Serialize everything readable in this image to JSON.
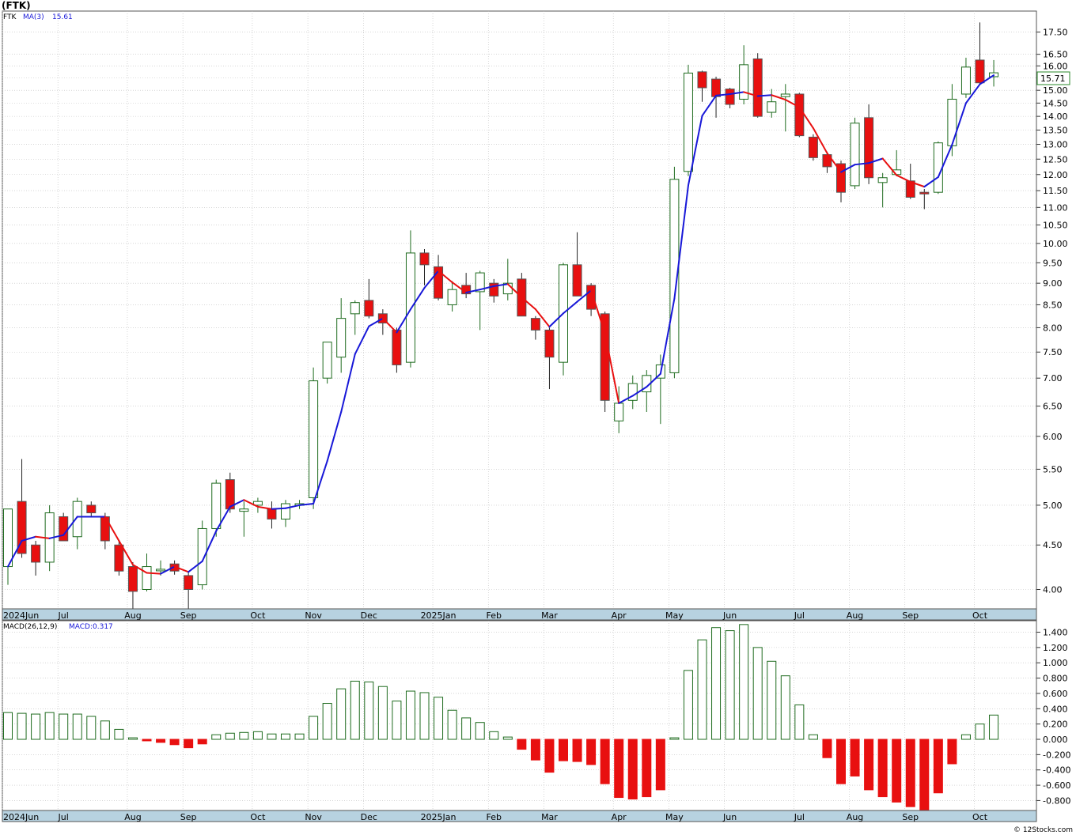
{
  "header": {
    "title": "(FTK)"
  },
  "footer": {
    "credit": "© 12Stocks.com"
  },
  "colors": {
    "up": "#1e6b1e",
    "down": "#e81010",
    "ma_up": "#1818d8",
    "ma_down": "#e81010",
    "grid": "#bdbdbd",
    "axis_band": "#b7d2e0"
  },
  "price_panel": {
    "legend": {
      "symbol": "FTK",
      "ma_label": "MA(3)",
      "ma_value": "15.61"
    },
    "last_price_label": "15.71"
  },
  "macd_panel": {
    "legend": {
      "name": "MACD(26,12,9)",
      "value_label": "MACD:0.317"
    }
  },
  "chart_data": [
    {
      "type": "candlestick",
      "title": "(FTK)",
      "scale": "log",
      "ylim": [
        3.8,
        18.5
      ],
      "y_ticks": [
        4.0,
        4.5,
        5.0,
        5.5,
        6.0,
        6.5,
        7.0,
        7.5,
        8.0,
        8.5,
        9.0,
        9.5,
        10.0,
        10.5,
        11.0,
        11.5,
        12.0,
        12.5,
        13.0,
        13.5,
        14.0,
        14.5,
        15.0,
        15.5,
        16.0,
        16.5,
        17.5
      ],
      "y_tick_labels": [
        "4.00",
        "4.50",
        "5.00",
        "5.50",
        "6.00",
        "6.50",
        "7.00",
        "7.50",
        "8.00",
        "8.50",
        "9.00",
        "9.50",
        "10.00",
        "10.50",
        "11.00",
        "11.50",
        "12.00",
        "12.50",
        "13.00",
        "13.50",
        "14.00",
        "14.50",
        "15.00",
        "15.50",
        "16.00",
        "16.50",
        "17.50"
      ],
      "x_labels": [
        {
          "label": "2024Jun",
          "week": 0
        },
        {
          "label": "Jul",
          "week": 4
        },
        {
          "label": "Aug",
          "week": 9
        },
        {
          "label": "Sep",
          "week": 13
        },
        {
          "label": "Oct",
          "week": 18
        },
        {
          "label": "Nov",
          "week": 22
        },
        {
          "label": "Dec",
          "week": 26
        },
        {
          "label": "2025Jan",
          "week": 31
        },
        {
          "label": "Feb",
          "week": 35
        },
        {
          "label": "Mar",
          "week": 39
        },
        {
          "label": "Apr",
          "week": 44
        },
        {
          "label": "May",
          "week": 48
        },
        {
          "label": "Jun",
          "week": 52
        },
        {
          "label": "Jul",
          "week": 57
        },
        {
          "label": "Aug",
          "week": 61
        },
        {
          "label": "Sep",
          "week": 65
        },
        {
          "label": "Oct",
          "week": 70
        }
      ],
      "grid": true,
      "candles": [
        {
          "o": 4.25,
          "h": 4.95,
          "l": 4.05,
          "c": 4.95
        },
        {
          "o": 5.05,
          "h": 5.65,
          "l": 4.35,
          "c": 4.4
        },
        {
          "o": 4.5,
          "h": 4.55,
          "l": 4.15,
          "c": 4.3
        },
        {
          "o": 4.3,
          "h": 5.0,
          "l": 4.2,
          "c": 4.9
        },
        {
          "o": 4.85,
          "h": 4.9,
          "l": 4.55,
          "c": 4.55
        },
        {
          "o": 4.6,
          "h": 5.1,
          "l": 4.45,
          "c": 5.05
        },
        {
          "o": 5.0,
          "h": 5.05,
          "l": 4.85,
          "c": 4.9
        },
        {
          "o": 4.85,
          "h": 4.9,
          "l": 4.45,
          "c": 4.55
        },
        {
          "o": 4.5,
          "h": 4.55,
          "l": 4.15,
          "c": 4.2
        },
        {
          "o": 4.25,
          "h": 4.3,
          "l": 3.8,
          "c": 3.98
        },
        {
          "o": 4.0,
          "h": 4.4,
          "l": 3.98,
          "c": 4.25
        },
        {
          "o": 4.22,
          "h": 4.32,
          "l": 4.15,
          "c": 4.22
        },
        {
          "o": 4.28,
          "h": 4.32,
          "l": 4.16,
          "c": 4.2
        },
        {
          "o": 4.15,
          "h": 4.2,
          "l": 3.8,
          "c": 4.0
        },
        {
          "o": 4.05,
          "h": 4.8,
          "l": 4.0,
          "c": 4.7
        },
        {
          "o": 4.7,
          "h": 5.35,
          "l": 4.6,
          "c": 5.3
        },
        {
          "o": 5.35,
          "h": 5.45,
          "l": 4.9,
          "c": 4.95
        },
        {
          "o": 4.92,
          "h": 5.05,
          "l": 4.6,
          "c": 4.95
        },
        {
          "o": 5.0,
          "h": 5.1,
          "l": 4.9,
          "c": 5.05
        },
        {
          "o": 4.95,
          "h": 5.05,
          "l": 4.7,
          "c": 4.82
        },
        {
          "o": 4.82,
          "h": 5.07,
          "l": 4.72,
          "c": 5.02
        },
        {
          "o": 5.0,
          "h": 5.07,
          "l": 4.95,
          "c": 5.02
        },
        {
          "o": 5.1,
          "h": 7.2,
          "l": 4.95,
          "c": 6.95
        },
        {
          "o": 7.0,
          "h": 7.7,
          "l": 6.9,
          "c": 7.7
        },
        {
          "o": 7.4,
          "h": 8.65,
          "l": 7.1,
          "c": 8.2
        },
        {
          "o": 8.3,
          "h": 8.6,
          "l": 7.85,
          "c": 8.55
        },
        {
          "o": 8.6,
          "h": 9.1,
          "l": 8.2,
          "c": 8.25
        },
        {
          "o": 8.3,
          "h": 8.4,
          "l": 7.85,
          "c": 8.1
        },
        {
          "o": 7.95,
          "h": 8.0,
          "l": 7.1,
          "c": 7.25
        },
        {
          "o": 7.3,
          "h": 10.35,
          "l": 7.2,
          "c": 9.75
        },
        {
          "o": 9.75,
          "h": 9.85,
          "l": 8.95,
          "c": 9.45
        },
        {
          "o": 9.4,
          "h": 9.7,
          "l": 8.6,
          "c": 8.65
        },
        {
          "o": 8.5,
          "h": 9.05,
          "l": 8.35,
          "c": 8.85
        },
        {
          "o": 8.95,
          "h": 9.25,
          "l": 8.65,
          "c": 8.75
        },
        {
          "o": 8.8,
          "h": 9.3,
          "l": 7.95,
          "c": 9.25
        },
        {
          "o": 9.0,
          "h": 9.1,
          "l": 8.55,
          "c": 8.7
        },
        {
          "o": 8.75,
          "h": 9.6,
          "l": 8.6,
          "c": 9.0
        },
        {
          "o": 9.1,
          "h": 9.25,
          "l": 8.25,
          "c": 8.25
        },
        {
          "o": 8.2,
          "h": 8.25,
          "l": 7.75,
          "c": 7.95
        },
        {
          "o": 7.95,
          "h": 8.0,
          "l": 6.8,
          "c": 7.4
        },
        {
          "o": 7.3,
          "h": 9.5,
          "l": 7.05,
          "c": 9.45
        },
        {
          "o": 9.45,
          "h": 10.3,
          "l": 8.8,
          "c": 8.7
        },
        {
          "o": 8.95,
          "h": 9.0,
          "l": 8.25,
          "c": 8.4
        },
        {
          "o": 8.3,
          "h": 8.35,
          "l": 6.4,
          "c": 6.6
        },
        {
          "o": 6.25,
          "h": 6.85,
          "l": 6.05,
          "c": 6.55
        },
        {
          "o": 6.6,
          "h": 7.05,
          "l": 6.45,
          "c": 6.9
        },
        {
          "o": 6.75,
          "h": 7.15,
          "l": 6.4,
          "c": 7.05
        },
        {
          "o": 7.0,
          "h": 7.45,
          "l": 6.2,
          "c": 7.25
        },
        {
          "o": 7.1,
          "h": 12.25,
          "l": 7.0,
          "c": 11.85
        },
        {
          "o": 12.1,
          "h": 16.05,
          "l": 11.95,
          "c": 15.7
        },
        {
          "o": 15.75,
          "h": 15.8,
          "l": 14.55,
          "c": 15.1
        },
        {
          "o": 15.45,
          "h": 15.55,
          "l": 13.95,
          "c": 14.75
        },
        {
          "o": 15.05,
          "h": 15.1,
          "l": 14.3,
          "c": 14.45
        },
        {
          "o": 14.65,
          "h": 16.9,
          "l": 14.45,
          "c": 16.05
        },
        {
          "o": 16.3,
          "h": 16.55,
          "l": 13.95,
          "c": 14.0
        },
        {
          "o": 14.15,
          "h": 15.05,
          "l": 13.95,
          "c": 14.55
        },
        {
          "o": 14.75,
          "h": 15.25,
          "l": 13.45,
          "c": 14.85
        },
        {
          "o": 14.85,
          "h": 14.9,
          "l": 13.25,
          "c": 13.3
        },
        {
          "o": 13.25,
          "h": 13.35,
          "l": 12.45,
          "c": 12.55
        },
        {
          "o": 12.65,
          "h": 12.75,
          "l": 12.05,
          "c": 12.25
        },
        {
          "o": 12.35,
          "h": 12.45,
          "l": 11.15,
          "c": 11.45
        },
        {
          "o": 11.65,
          "h": 13.95,
          "l": 11.55,
          "c": 13.75
        },
        {
          "o": 13.95,
          "h": 14.45,
          "l": 11.7,
          "c": 11.9
        },
        {
          "o": 11.75,
          "h": 12.05,
          "l": 11.0,
          "c": 11.9
        },
        {
          "o": 12.0,
          "h": 12.8,
          "l": 11.95,
          "c": 12.15
        },
        {
          "o": 11.8,
          "h": 12.35,
          "l": 11.25,
          "c": 11.3
        },
        {
          "o": 11.45,
          "h": 11.55,
          "l": 10.95,
          "c": 11.4
        },
        {
          "o": 11.45,
          "h": 13.1,
          "l": 11.4,
          "c": 13.05
        },
        {
          "o": 12.95,
          "h": 15.25,
          "l": 12.6,
          "c": 14.65
        },
        {
          "o": 14.85,
          "h": 16.35,
          "l": 14.7,
          "c": 15.95
        },
        {
          "o": 16.25,
          "h": 17.95,
          "l": 15.25,
          "c": 15.3
        },
        {
          "o": 15.55,
          "h": 16.25,
          "l": 15.15,
          "c": 15.71
        }
      ],
      "ma": {
        "label": "MA(3)",
        "values": [
          4.25,
          4.55,
          4.6,
          4.58,
          4.62,
          4.85,
          4.85,
          4.85,
          4.55,
          4.27,
          4.18,
          4.17,
          4.25,
          4.19,
          4.31,
          4.67,
          4.98,
          5.07,
          4.98,
          4.95,
          4.96,
          5.0,
          5.02,
          5.62,
          6.4,
          7.46,
          8.03,
          8.2,
          7.9,
          8.4,
          8.89,
          9.3,
          9.02,
          8.78,
          8.85,
          8.93,
          8.98,
          8.67,
          8.4,
          8.02,
          8.31,
          8.57,
          8.83,
          7.88,
          6.55,
          6.68,
          6.84,
          7.08,
          8.64,
          11.66,
          14.02,
          14.79,
          14.85,
          14.93,
          14.77,
          14.81,
          14.63,
          14.34,
          13.57,
          12.7,
          12.08,
          12.32,
          12.37,
          12.52,
          11.98,
          11.77,
          11.62,
          11.92,
          12.99,
          14.5,
          15.24,
          15.61
        ]
      }
    },
    {
      "type": "bar",
      "title": "MACD(26,12,9)",
      "value_label": "MACD:0.317",
      "ylim": [
        -0.93,
        1.55
      ],
      "y_ticks": [
        -0.8,
        -0.6,
        -0.4,
        -0.2,
        0.0,
        0.2,
        0.4,
        0.6,
        0.8,
        1.0,
        1.2,
        1.4
      ],
      "y_tick_labels": [
        "-0.800",
        "-0.600",
        "-0.400",
        "-0.200",
        "0.000",
        "0.200",
        "0.400",
        "0.600",
        "0.800",
        "1.000",
        "1.200",
        "1.400"
      ],
      "x_labels": [
        {
          "label": "2024Jun",
          "week": 0
        },
        {
          "label": "Jul",
          "week": 4
        },
        {
          "label": "Aug",
          "week": 9
        },
        {
          "label": "Sep",
          "week": 13
        },
        {
          "label": "Oct",
          "week": 18
        },
        {
          "label": "Nov",
          "week": 22
        },
        {
          "label": "Dec",
          "week": 26
        },
        {
          "label": "2025Jan",
          "week": 31
        },
        {
          "label": "Feb",
          "week": 35
        },
        {
          "label": "Mar",
          "week": 39
        },
        {
          "label": "Apr",
          "week": 44
        },
        {
          "label": "May",
          "week": 48
        },
        {
          "label": "Jun",
          "week": 52
        },
        {
          "label": "Jul",
          "week": 57
        },
        {
          "label": "Aug",
          "week": 61
        },
        {
          "label": "Sep",
          "week": 65
        },
        {
          "label": "Oct",
          "week": 70
        }
      ],
      "grid": true,
      "values": [
        0.35,
        0.34,
        0.33,
        0.35,
        0.33,
        0.33,
        0.3,
        0.24,
        0.13,
        0.02,
        -0.02,
        -0.04,
        -0.07,
        -0.11,
        -0.06,
        0.06,
        0.08,
        0.09,
        0.1,
        0.07,
        0.07,
        0.07,
        0.3,
        0.47,
        0.66,
        0.76,
        0.75,
        0.69,
        0.5,
        0.63,
        0.61,
        0.55,
        0.38,
        0.28,
        0.22,
        0.1,
        0.03,
        -0.13,
        -0.27,
        -0.43,
        -0.28,
        -0.29,
        -0.33,
        -0.58,
        -0.76,
        -0.78,
        -0.75,
        -0.66,
        0.02,
        0.9,
        1.3,
        1.46,
        1.42,
        1.5,
        1.2,
        1.02,
        0.83,
        0.45,
        0.06,
        -0.24,
        -0.58,
        -0.48,
        -0.66,
        -0.75,
        -0.82,
        -0.88,
        -0.93,
        -0.7,
        -0.32,
        0.06,
        0.2,
        0.317
      ]
    }
  ]
}
